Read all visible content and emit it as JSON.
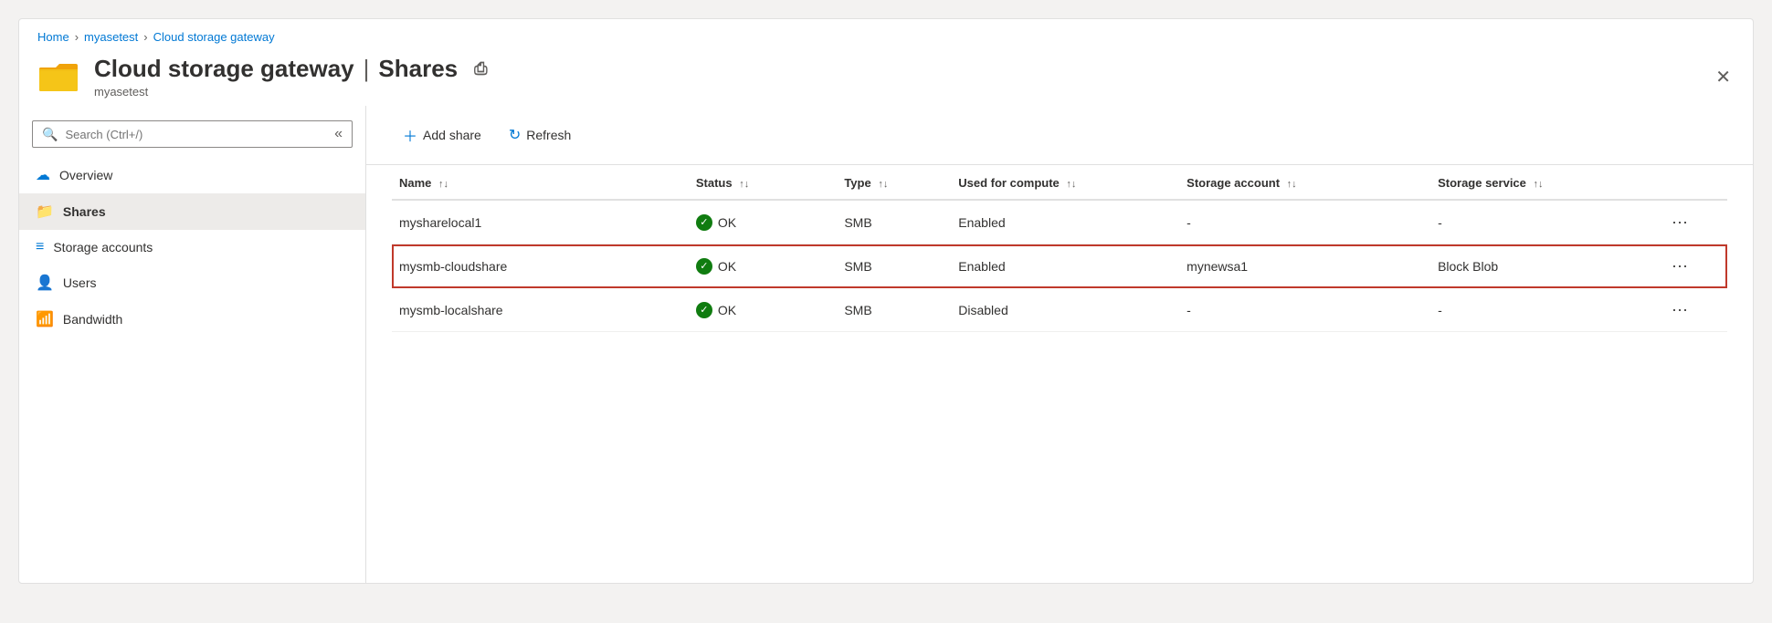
{
  "breadcrumb": {
    "home": "Home",
    "device": "myasetest",
    "current": "Cloud storage gateway"
  },
  "header": {
    "title": "Cloud storage gateway",
    "section": "Shares",
    "subtitle": "myasetest",
    "print_label": "Print",
    "close_label": "Close"
  },
  "search": {
    "placeholder": "Search (Ctrl+/)"
  },
  "nav": {
    "items": [
      {
        "id": "overview",
        "label": "Overview",
        "icon": "cloud"
      },
      {
        "id": "shares",
        "label": "Shares",
        "icon": "folder",
        "active": true
      },
      {
        "id": "storage-accounts",
        "label": "Storage accounts",
        "icon": "storage"
      },
      {
        "id": "users",
        "label": "Users",
        "icon": "user"
      },
      {
        "id": "bandwidth",
        "label": "Bandwidth",
        "icon": "bandwidth"
      }
    ]
  },
  "toolbar": {
    "add_share": "Add share",
    "refresh": "Refresh"
  },
  "table": {
    "columns": [
      {
        "id": "name",
        "label": "Name"
      },
      {
        "id": "status",
        "label": "Status"
      },
      {
        "id": "type",
        "label": "Type"
      },
      {
        "id": "used_for_compute",
        "label": "Used for compute"
      },
      {
        "id": "storage_account",
        "label": "Storage account"
      },
      {
        "id": "storage_service",
        "label": "Storage service"
      }
    ],
    "rows": [
      {
        "name": "mysharelocal1",
        "status": "OK",
        "type": "SMB",
        "used_for_compute": "Enabled",
        "storage_account": "-",
        "storage_service": "-",
        "selected": false
      },
      {
        "name": "mysmb-cloudshare",
        "status": "OK",
        "type": "SMB",
        "used_for_compute": "Enabled",
        "storage_account": "mynewsa1",
        "storage_service": "Block Blob",
        "selected": true
      },
      {
        "name": "mysmb-localshare",
        "status": "OK",
        "type": "SMB",
        "used_for_compute": "Disabled",
        "storage_account": "-",
        "storage_service": "-",
        "selected": false
      }
    ]
  }
}
